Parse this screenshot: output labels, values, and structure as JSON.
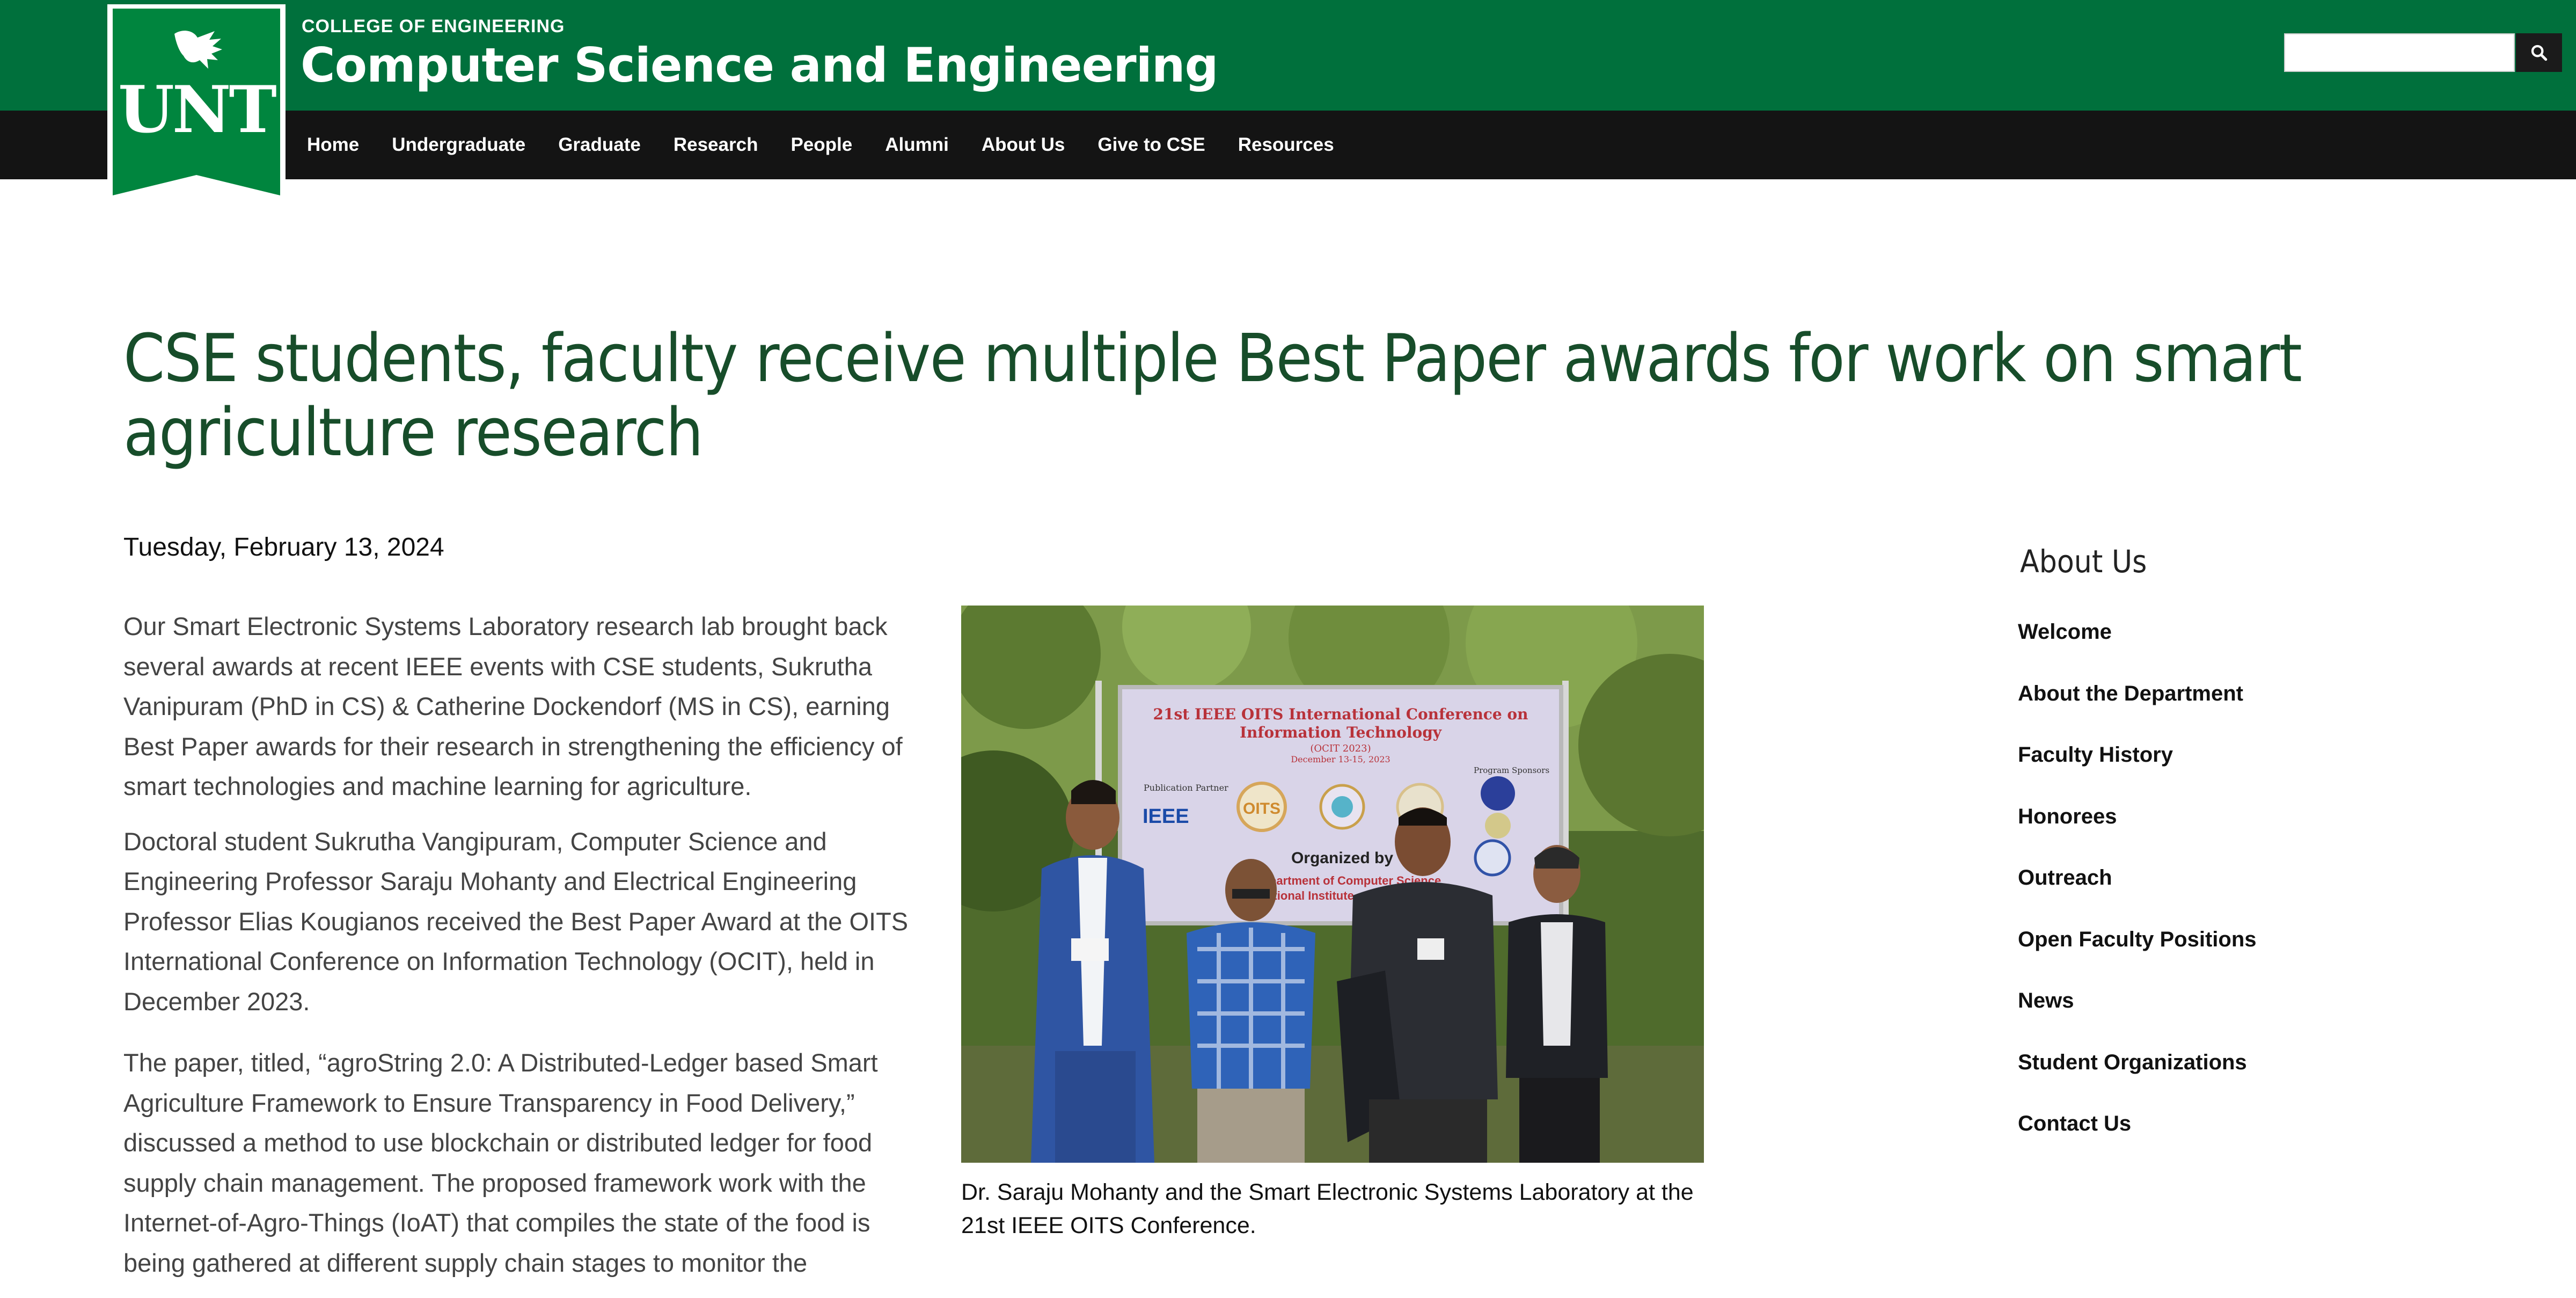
{
  "header": {
    "college": "COLLEGE OF ENGINEERING",
    "department": "Computer Science and Engineering",
    "logo_text": "UNT",
    "search": {
      "value": "",
      "placeholder": ""
    }
  },
  "nav": {
    "items": [
      "Home",
      "Undergraduate",
      "Graduate",
      "Research",
      "People",
      "Alumni",
      "About Us",
      "Give to CSE",
      "Resources"
    ]
  },
  "article": {
    "title": "CSE students, faculty receive multiple Best Paper awards for work on smart agriculture research",
    "date": "Tuesday, February 13, 2024",
    "paragraphs": [
      "Our Smart Electronic Systems Laboratory research lab brought back several awards at recent IEEE events with CSE students, Sukrutha Vanipuram (PhD in CS) & Catherine Dockendorf (MS in CS), earning Best Paper awards for their research in strengthening the efficiency of smart technologies and machine learning for agriculture.",
      "Doctoral student Sukrutha Vangipuram, Computer Science and Engineering Professor Saraju Mohanty and Electrical Engineering Professor Elias Kougianos received the Best Paper Award at the OITS International Conference on Information Technology (OCIT), held in December 2023.",
      "The paper, titled, “agroString 2.0: A Distributed-Ledger based Smart Agriculture Framework to Ensure Transparency in Food Delivery,” discussed a method to use blockchain or distributed ledger for food supply chain management. The proposed framework work with the Internet-of-Agro-Things (IoAT) that compiles the state of the food is being gathered at different supply chain stages to monitor the"
    ],
    "photo": {
      "banner_line1": "21st IEEE OITS International Conference on",
      "banner_line2": "Information Technology",
      "banner_line3": "(OCIT 2023)",
      "banner_line4": "December 13-15, 2023",
      "publication_partner": "Publication Partner",
      "ieee": "IEEE",
      "oits": "OITS",
      "program_sponsors": "Program Sponsors",
      "organized_by": "Organized by",
      "dept_fragment": "Department of Computer Science",
      "nit_fragment": "National Institute of Technology"
    },
    "caption": "Dr. Saraju Mohanty and the Smart Electronic Systems Laboratory at the 21st IEEE OITS Conference."
  },
  "sidebar": {
    "title": "About Us",
    "items": [
      "Welcome",
      "About the Department",
      "Faculty History",
      "Honorees",
      "Outreach",
      "Open Faculty Positions",
      "News",
      "Student Organizations",
      "Contact Us"
    ]
  },
  "colors": {
    "brand_green": "#00703c",
    "nav_black": "#141414",
    "title_green": "#174d2a"
  },
  "icons": {
    "search": "search-icon",
    "logo": "eagle-icon"
  }
}
